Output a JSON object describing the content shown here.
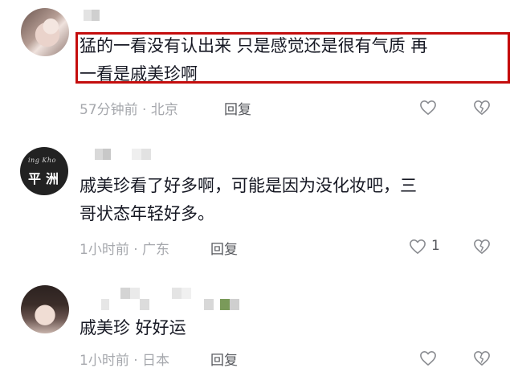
{
  "comments": [
    {
      "text_line1": "猛的一看没有认出来 只是感觉还是很有气质 再",
      "text_line2": "一看是戚美珍啊",
      "time_location": "57分钟前 · 北京",
      "reply_label": "回复",
      "like_count": ""
    },
    {
      "avatar_text_top": "ing Kho",
      "avatar_text_mid": "平洲",
      "text_line1": "戚美珍看了好多啊，可能是因为没化妆吧，三",
      "text_line2": "哥状态年轻好多。",
      "time_location": "1小时前 · 广东",
      "reply_label": "回复",
      "like_count": "1"
    },
    {
      "text_line1": "戚美珍 好好运",
      "time_location": "1小时前 · 日本",
      "reply_label": "回复",
      "like_count": ""
    }
  ],
  "colors": {
    "highlight_border": "#c40d0d",
    "text_primary": "#161823",
    "text_secondary": "#a6a8ad",
    "reply_text": "#57595e"
  },
  "icons": [
    "heart-outline-icon",
    "broken-heart-icon"
  ]
}
